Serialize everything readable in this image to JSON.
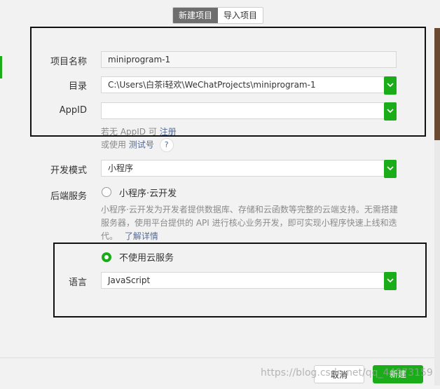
{
  "tabs": [
    {
      "label": "新建项目",
      "active": true
    },
    {
      "label": "导入项目",
      "active": false
    }
  ],
  "form": {
    "name": {
      "label": "项目名称",
      "value": "miniprogram-1"
    },
    "directory": {
      "label": "目录",
      "value": "C:\\Users\\白茶i轻欢\\WeChatProjects\\miniprogram-1"
    },
    "appid": {
      "label": "AppID",
      "value": ""
    },
    "appid_hint": {
      "prefix": "若无 AppID 可",
      "register_link": "注册"
    },
    "test_hint": {
      "prefix": "或使用",
      "test_link": "测试号",
      "help": "?"
    },
    "dev_mode": {
      "label": "开发模式",
      "value": "小程序"
    },
    "backend": {
      "label": "后端服务",
      "option_cloud": "小程序·云开发",
      "description": "小程序·云开发为开发者提供数据库、存储和云函数等完整的云端支持。无需搭建服务器，使用平台提供的 API 进行核心业务开发，即可实现小程序快速上线和迭代。",
      "learn_more": "了解详情",
      "option_none": "不使用云服务",
      "selected": "option_none"
    },
    "language": {
      "label": "语言",
      "value": "JavaScript"
    }
  },
  "footer": {
    "cancel_label": "取消",
    "create_label": "新建"
  },
  "watermark": "https://blog.csdn.net/qq_44073159",
  "colors": {
    "accent": "#1aad19",
    "link": "#576b95"
  }
}
